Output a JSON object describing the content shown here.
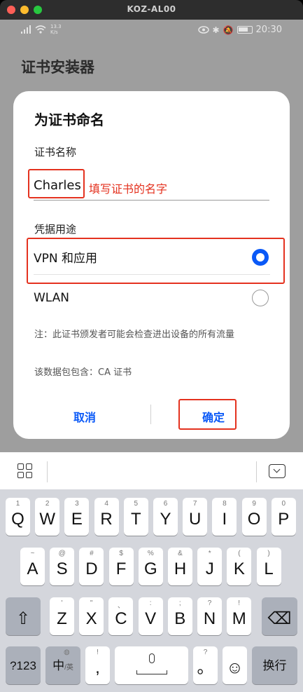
{
  "window": {
    "title": "KOZ-AL00"
  },
  "statusbar": {
    "net_speed": "13.3\nK/s",
    "time": "20:30"
  },
  "app": {
    "title": "证书安装器"
  },
  "dialog": {
    "title": "为证书命名",
    "name_label": "证书名称",
    "name_value": "Charles",
    "annotation": "填写证书的名字",
    "credential_label": "凭据用途",
    "options": [
      {
        "label": "VPN 和应用",
        "selected": true
      },
      {
        "label": "WLAN",
        "selected": false
      }
    ],
    "note": "注：此证书颁发者可能会检查进出设备的所有流量",
    "package_note": "该数据包包含：CA 证书",
    "cancel_label": "取消",
    "ok_label": "确定"
  },
  "keyboard": {
    "row1": [
      {
        "main": "Q",
        "sub": "1"
      },
      {
        "main": "W",
        "sub": "2"
      },
      {
        "main": "E",
        "sub": "3"
      },
      {
        "main": "R",
        "sub": "4"
      },
      {
        "main": "T",
        "sub": "5"
      },
      {
        "main": "Y",
        "sub": "6"
      },
      {
        "main": "U",
        "sub": "7"
      },
      {
        "main": "I",
        "sub": "8"
      },
      {
        "main": "O",
        "sub": "9"
      },
      {
        "main": "P",
        "sub": "0"
      }
    ],
    "row2": [
      {
        "main": "A",
        "sub": "~"
      },
      {
        "main": "S",
        "sub": "@"
      },
      {
        "main": "D",
        "sub": "#"
      },
      {
        "main": "F",
        "sub": "$"
      },
      {
        "main": "G",
        "sub": "%"
      },
      {
        "main": "H",
        "sub": "&"
      },
      {
        "main": "J",
        "sub": "*"
      },
      {
        "main": "K",
        "sub": "("
      },
      {
        "main": "L",
        "sub": ")"
      }
    ],
    "row3": [
      {
        "main": "Z",
        "sub": "'"
      },
      {
        "main": "X",
        "sub": "\""
      },
      {
        "main": "C",
        "sub": "、"
      },
      {
        "main": "V",
        "sub": ":"
      },
      {
        "main": "B",
        "sub": ";"
      },
      {
        "main": "N",
        "sub": "?"
      },
      {
        "main": "M",
        "sub": "!"
      }
    ],
    "shift": "⇧",
    "delete": "⌫",
    "num_key": "?123",
    "lang_key": "中",
    "lang_sub": "/英",
    "comma": ",",
    "comma_sub": "!",
    "period": "。",
    "period_sub": "?",
    "enter": "换行",
    "emoji": "☺"
  }
}
